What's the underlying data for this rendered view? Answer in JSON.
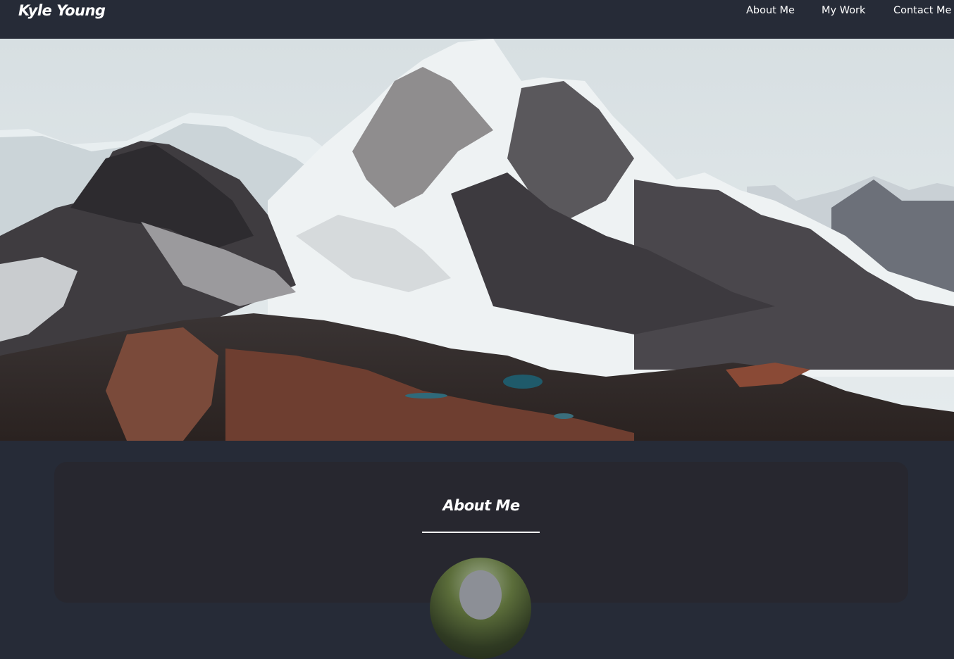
{
  "navbar": {
    "brand": "Kyle Young",
    "links": [
      {
        "label": "About Me"
      },
      {
        "label": "My Work"
      },
      {
        "label": "Contact Me"
      }
    ]
  },
  "hero": {
    "image": "mountain-landscape"
  },
  "about": {
    "title": "About Me",
    "avatar": "profile-photo"
  },
  "colors": {
    "background": "#262b37",
    "card": "#27272f",
    "text": "#ffffff"
  }
}
